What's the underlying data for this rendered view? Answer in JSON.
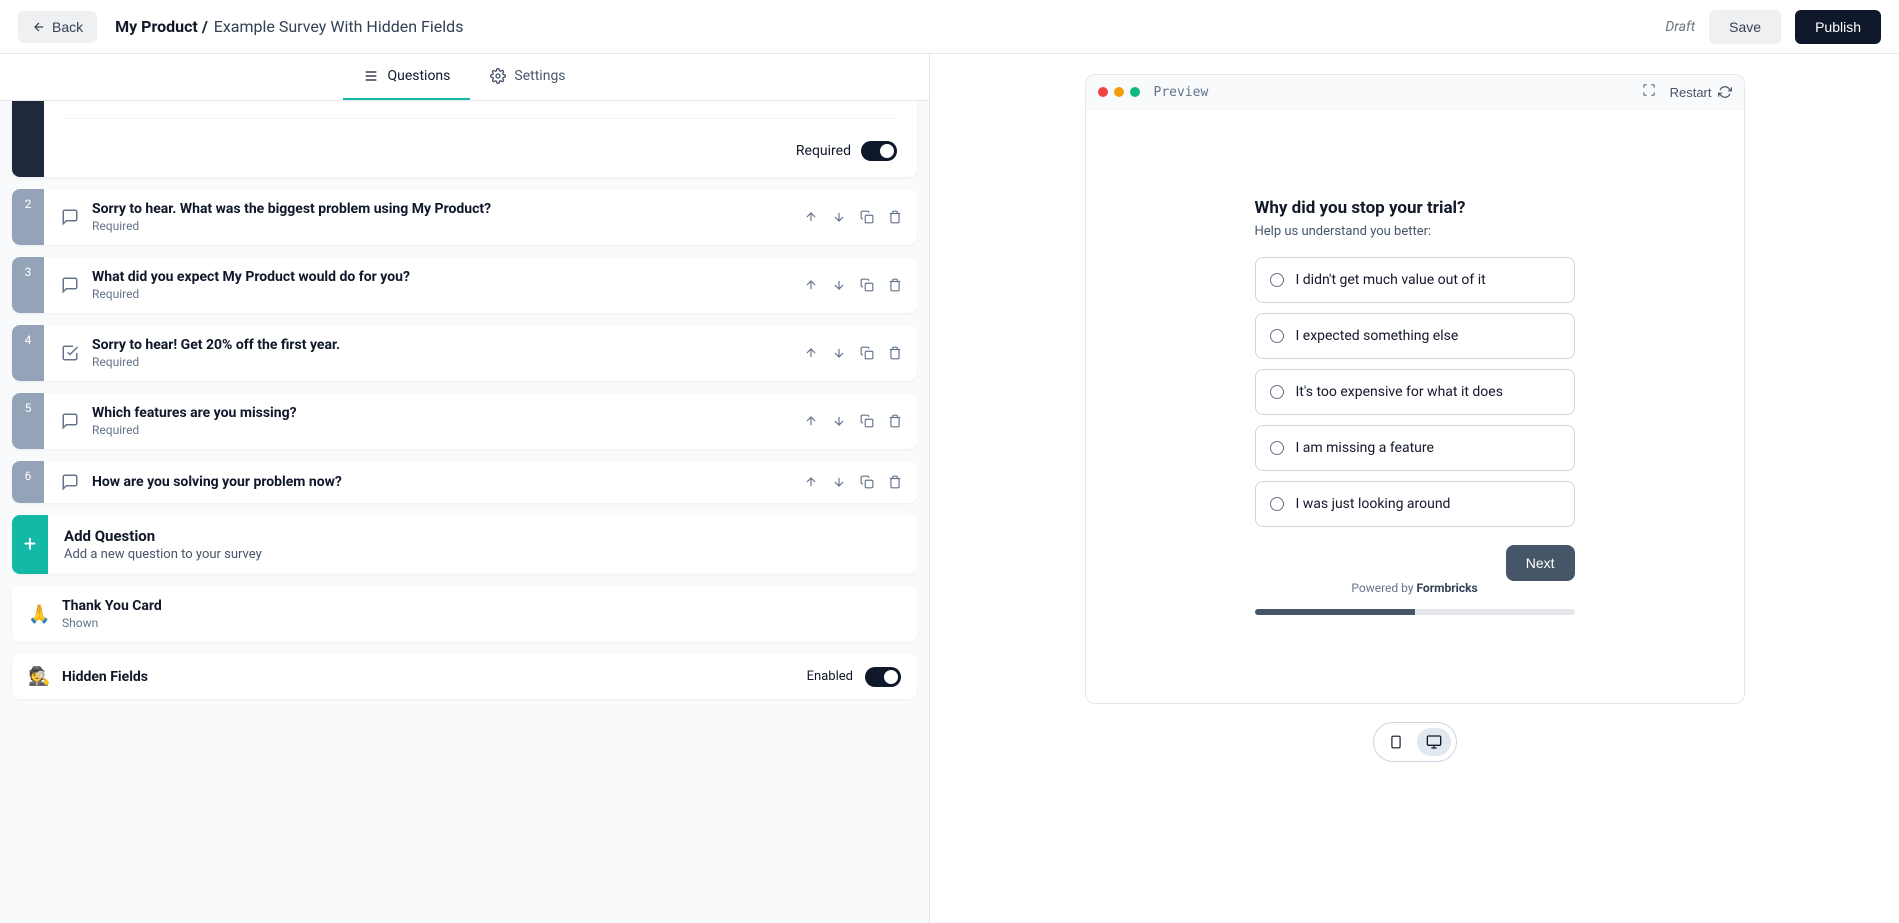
{
  "header": {
    "back": "Back",
    "product": "My Product /",
    "survey": "Example Survey With Hidden Fields",
    "draft": "Draft",
    "save": "Save",
    "publish": "Publish"
  },
  "tabs": {
    "questions": "Questions",
    "settings": "Settings"
  },
  "required_label": "Required",
  "questions": [
    {
      "n": "2",
      "title": "Sorry to hear. What was the biggest problem using My Product?",
      "required": "Required",
      "type": "text"
    },
    {
      "n": "3",
      "title": "What did you expect My Product would do for you?",
      "required": "Required",
      "type": "text"
    },
    {
      "n": "4",
      "title": "Sorry to hear! Get 20% off the first year.",
      "required": "Required",
      "type": "cta"
    },
    {
      "n": "5",
      "title": "Which features are you missing?",
      "required": "Required",
      "type": "text"
    },
    {
      "n": "6",
      "title": "How are you solving your problem now?",
      "required": "",
      "type": "text"
    }
  ],
  "add_question": {
    "title": "Add Question",
    "sub": "Add a new question to your survey"
  },
  "thankyou": {
    "title": "Thank You Card",
    "sub": "Shown"
  },
  "hidden": {
    "title": "Hidden Fields",
    "status": "Enabled"
  },
  "preview": {
    "label": "Preview",
    "restart": "Restart",
    "question": "Why did you stop your trial?",
    "help": "Help us understand you better:",
    "options": [
      "I didn't get much value out of it",
      "I expected something else",
      "It's too expensive for what it does",
      "I am missing a feature",
      "I was just looking around"
    ],
    "next": "Next",
    "powered_pre": "Powered by ",
    "powered_brand": "Formbricks"
  }
}
